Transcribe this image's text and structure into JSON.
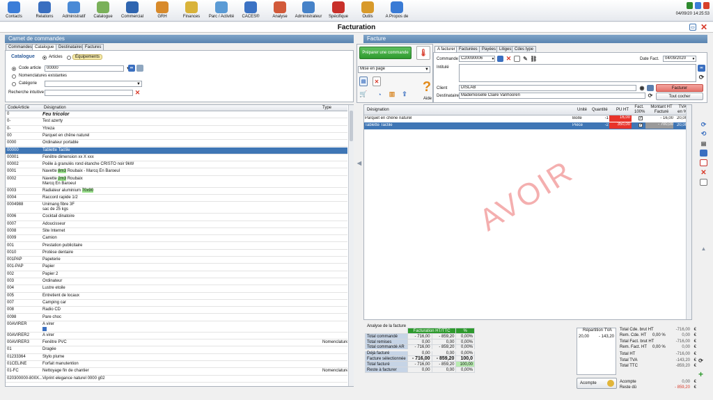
{
  "toolbar": {
    "items": [
      {
        "label": "Contacts",
        "icon": "contacts-icon",
        "color": "#3b7dd8"
      },
      {
        "label": "Relations",
        "icon": "relations-icon",
        "color": "#3a6fc0"
      },
      {
        "label": "Administratif",
        "icon": "administratif-icon",
        "color": "#4a8ad6"
      },
      {
        "label": "Catalogue",
        "icon": "catalogue-icon",
        "color": "#7ab15a"
      },
      {
        "label": "Commercial",
        "icon": "commercial-icon",
        "color": "#2f65b0"
      },
      {
        "label": "GRH",
        "icon": "grh-icon",
        "color": "#d88a2b"
      },
      {
        "label": "Finances",
        "icon": "finances-icon",
        "color": "#d9b33a"
      },
      {
        "label": "Parc / Activité",
        "icon": "parc-icon",
        "color": "#5b9bd5"
      },
      {
        "label": "CACES®",
        "icon": "caces-icon",
        "color": "#3b72c4"
      },
      {
        "label": "Analyse",
        "icon": "analyse-icon",
        "color": "#d25a3a"
      },
      {
        "label": "Administrateur",
        "icon": "administrateur-icon",
        "color": "#4682c8"
      },
      {
        "label": "Spécifique",
        "icon": "specifique-icon",
        "color": "#c8302a"
      },
      {
        "label": "Outils",
        "icon": "outils-icon",
        "color": "#d89a2b"
      },
      {
        "label": "A Propos de",
        "icon": "apropos-icon",
        "color": "#3a7bd5"
      }
    ],
    "datetime": "04/09/20 14:25:53"
  },
  "window": {
    "title": "Facturation"
  },
  "left": {
    "header": "Carnet de commandes",
    "tabs": [
      "Commandes",
      "Catalogue",
      "Destinataires",
      "Factures"
    ],
    "catalogue_label": "Catalogue",
    "type_options": [
      "Articles",
      "Équipements"
    ],
    "code_article_label": "Code article",
    "code_article_value": "00000",
    "nomenclatures_label": "Nomenclatures existantes",
    "categorie_label": "Catégorie",
    "recherche_label": "Recherche intuitive",
    "columns": [
      "CodeArticle",
      "Désignation",
      "Type"
    ],
    "rows": [
      {
        "code": "0",
        "designation": "Feu tricolor",
        "type": ""
      },
      {
        "code": "0-",
        "designation": "Test azerty",
        "type": ""
      },
      {
        "code": "0-",
        "designation": "Ytreza",
        "type": ""
      },
      {
        "code": "00",
        "designation": "Parquet en chêne naturel",
        "type": ""
      },
      {
        "code": "0000",
        "designation": "Ordinateur portable",
        "type": ""
      },
      {
        "code": "00000",
        "designation": "Tablette Tactile",
        "type": ""
      },
      {
        "code": "00001",
        "designation": "Fenêtre dimension xx X xxx",
        "type": ""
      },
      {
        "code": "00002",
        "designation": "Poêle à granulés rond étanche CRISTO noir 9kW",
        "type": ""
      },
      {
        "code": "0001",
        "designation": "Navette 8m3 Roubaix - Marcq En Baroeul",
        "type": ""
      },
      {
        "code": "0002",
        "designation": "Navette 2m3 Roubaix",
        "designation2": "Marcq En Baroeul",
        "type": ""
      },
      {
        "code": "0003",
        "designation": "Radiateur aluminium 70x90",
        "type": ""
      },
      {
        "code": "0004",
        "designation": "Raccord rapide 1/2",
        "type": ""
      },
      {
        "code": "0004988",
        "designation": "Unimang fibre 3F",
        "designation2": "sac de 25 kgs",
        "type": ""
      },
      {
        "code": "0006",
        "designation": "Cocktail dinatoire",
        "type": ""
      },
      {
        "code": "0007",
        "designation": "Adoucisseur",
        "type": ""
      },
      {
        "code": "0008",
        "designation": "Site Internet",
        "type": ""
      },
      {
        "code": "0009",
        "designation": "Camion",
        "type": ""
      },
      {
        "code": "001",
        "designation": "Prestation publicitaire",
        "type": ""
      },
      {
        "code": "0010",
        "designation": "Protèse dentaire",
        "type": ""
      },
      {
        "code": "001PAP",
        "designation": "Papeterie",
        "type": ""
      },
      {
        "code": "001-PAP",
        "designation": "Papier",
        "type": ""
      },
      {
        "code": "002",
        "designation": "Papier 2",
        "type": ""
      },
      {
        "code": "003",
        "designation": "Ordinateur",
        "type": ""
      },
      {
        "code": "004",
        "designation": "Lustre etoile",
        "type": ""
      },
      {
        "code": "005",
        "designation": "Entretient de locaux",
        "type": ""
      },
      {
        "code": "007",
        "designation": "Camping car",
        "type": ""
      },
      {
        "code": "008",
        "designation": "Radio CD",
        "type": ""
      },
      {
        "code": "0098",
        "designation": "Pare choc",
        "type": ""
      },
      {
        "code": "00AVIRER",
        "designation": "A virer",
        "type": ""
      },
      {
        "code": "00AVIRER2",
        "designation": "A virer",
        "type": ""
      },
      {
        "code": "00AVIRER3",
        "designation": "Fenêtre PVC",
        "type": "Nomenclature"
      },
      {
        "code": "01",
        "designation": "Dragée",
        "type": ""
      },
      {
        "code": "01233364",
        "designation": "Stylo plume",
        "type": ""
      },
      {
        "code": "01CÉLINE",
        "designation": "Forfait manutention",
        "type": ""
      },
      {
        "code": "01-FC",
        "designation": "Nettoyage fin de chantier",
        "type": "Nomenclature"
      },
      {
        "code": "020300000-800X...",
        "designation": "Viprint elegance naturel 0000 g02",
        "type": ""
      }
    ]
  },
  "right": {
    "header": "Facture",
    "preparer_label": "Préparer une commande",
    "mise_en_page": "Mise en page",
    "aide_label": "Aide",
    "tabs": [
      "A facturer",
      "Facturées",
      "Payées",
      "Litiges",
      "Cdes type"
    ],
    "commande_label": "Commande",
    "commande_value": "C20090006",
    "date_label": "Date Fact.",
    "date_value": "04/09/2020",
    "intitule_label": "Intitulé",
    "client_label": "Client",
    "client_value": "DISLAB",
    "destinataire_label": "Destinataire",
    "destinataire_value": "Mademoiselle Claire Vanhooren",
    "facturer_label": "Facturer",
    "tout_cocher_label": "Tout cocher",
    "columns": [
      "Désignation",
      "Unité",
      "Quantité",
      "PU HT",
      "Fact. 100%",
      "Montant HT Facturé",
      "TVA en %"
    ],
    "lines": [
      {
        "designation": "Parquet en chêne naturel",
        "unite": "Boite",
        "quantite": "-1",
        "pu": "16,00",
        "fact": "✓",
        "montant": "- 16,00",
        "tva": "20,00"
      },
      {
        "designation": "Tablette Tactile",
        "unite": "Pièce",
        "quantite": "-2",
        "pu": "350,00",
        "fact": "✓",
        "montant": "- 700,00",
        "tva": "20,00"
      }
    ],
    "watermark": "AVOIR",
    "analyse": {
      "title": "Analyse de la facture",
      "col_head": "Facturation HT/TTC",
      "col_pct": "%",
      "rows": [
        {
          "label": "Total commandé",
          "ht": "- 716,00",
          "ttc": "- 859,20",
          "pct": "0,00%"
        },
        {
          "label": "Total remises",
          "ht": "0,00",
          "ttc": "0,00",
          "pct": "0,00%"
        },
        {
          "label": "Total commandé AR",
          "ht": "- 716,00",
          "ttc": "- 859,20",
          "pct": "0,00%"
        },
        {
          "label": "Déjà facturé",
          "ht": "0,00",
          "ttc": "0,00",
          "pct": "0,00%"
        },
        {
          "label": "Facture sélectionnée",
          "ht": "- 716,00",
          "ttc": "- 859,20",
          "pct": "100,0"
        },
        {
          "label": "Total facturé",
          "ht": "- 716,00",
          "ttc": "- 859,20",
          "pct": "100,00"
        },
        {
          "label": "Reste à facturer",
          "ht": "0,00",
          "ttc": "0,00",
          "pct": "0,00%"
        }
      ]
    },
    "repartition": {
      "title": "Répartition TVA",
      "rate": "20,00",
      "amount": "- 143,20"
    },
    "acompte_label": "Acompte",
    "totals": [
      {
        "label": "Total Cde. brut HT",
        "pct": "",
        "value": "-716,00"
      },
      {
        "label": "Rem. Cde. HT",
        "pct": "0,00 %",
        "value": "0,00"
      },
      {
        "label": "Total Fact. brut HT",
        "pct": "",
        "value": "-716,00"
      },
      {
        "label": "Rem. Fact. HT",
        "pct": "0,00 %",
        "value": "0,00"
      },
      {
        "label": "Total HT",
        "pct": "",
        "value": "-716,00"
      },
      {
        "label": "Total TVA",
        "pct": "",
        "value": "-143,20"
      },
      {
        "label": "Total TTC",
        "pct": "",
        "value": "-859,20"
      }
    ],
    "acompte_total": {
      "label": "Acompte",
      "value": "0,00"
    },
    "reste_du": {
      "label": "Reste dû",
      "value": "- 859,20"
    },
    "currency": "€"
  },
  "colors": {
    "accent": "#3f76b5",
    "header": "#5a84b0",
    "green": "#2e9a2e",
    "red": "#d83a2a",
    "watermark": "#eb6e6e"
  }
}
